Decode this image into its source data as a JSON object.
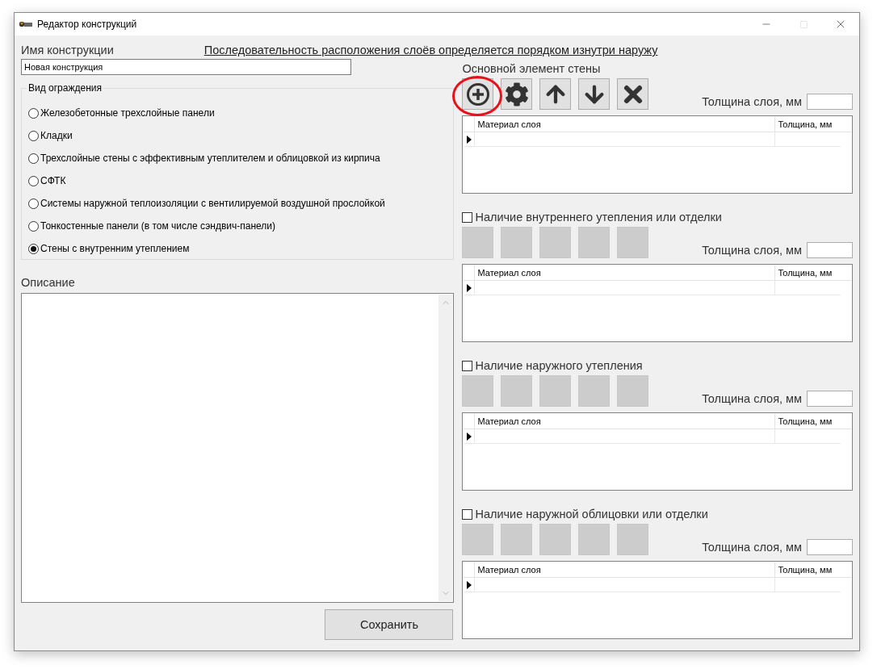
{
  "window": {
    "title": "Редактор конструкций"
  },
  "name_field": {
    "label": "Имя конструкции",
    "value": "Новая конструкция"
  },
  "hint_link": "Последовательность расположения слоёв определяется порядком изнутри наружу",
  "enclosure_group": {
    "title": "Вид ограждения",
    "options": [
      {
        "label": "Железобетонные трехслойные панели",
        "selected": false
      },
      {
        "label": "Кладки",
        "selected": false
      },
      {
        "label": "Трехслойные стены с эффективным утеплителем и облицовкой из кирпича",
        "selected": false
      },
      {
        "label": "СФТК",
        "selected": false
      },
      {
        "label": "Системы наружной теплоизоляции с вентилируемой воздушной прослойкой",
        "selected": false
      },
      {
        "label": "Тонкостенные панели (в том числе сэндвич-панели)",
        "selected": false
      },
      {
        "label": "Стены с внутренним утеплением",
        "selected": true
      }
    ]
  },
  "description": {
    "label": "Описание"
  },
  "save_button": "Сохранить",
  "sections": [
    {
      "kind": "label",
      "title": "Основной элемент стены",
      "buttons": [
        {
          "kind": "add",
          "highlighted": true
        },
        {
          "kind": "settings",
          "highlighted": false
        },
        {
          "kind": "up",
          "highlighted": false
        },
        {
          "kind": "down",
          "highlighted": false
        },
        {
          "kind": "delete",
          "highlighted": false
        }
      ],
      "thickness_label": "Толщина слоя, мм",
      "columns": [
        "Материал слоя",
        "Толщина, мм"
      ]
    },
    {
      "kind": "checkbox",
      "checked": false,
      "title": "Наличие внутреннего утепления или отделки",
      "buttons": [
        {
          "kind": "blank",
          "highlighted": false
        },
        {
          "kind": "blank",
          "highlighted": false
        },
        {
          "kind": "blank",
          "highlighted": false
        },
        {
          "kind": "blank",
          "highlighted": false
        },
        {
          "kind": "blank",
          "highlighted": false
        }
      ],
      "thickness_label": "Толщина слоя, мм",
      "columns": [
        "Материал слоя",
        "Толщина, мм"
      ]
    },
    {
      "kind": "checkbox",
      "checked": false,
      "title": "Наличие наружного утепления",
      "buttons": [
        {
          "kind": "blank",
          "highlighted": false
        },
        {
          "kind": "blank",
          "highlighted": false
        },
        {
          "kind": "blank",
          "highlighted": false
        },
        {
          "kind": "blank",
          "highlighted": false
        },
        {
          "kind": "blank",
          "highlighted": false
        }
      ],
      "thickness_label": "Толщина слоя, мм",
      "columns": [
        "Материал слоя",
        "Толщина, мм"
      ]
    },
    {
      "kind": "checkbox",
      "checked": false,
      "title": "Наличие наружной облицовки или отделки",
      "buttons": [
        {
          "kind": "blank",
          "highlighted": false
        },
        {
          "kind": "blank",
          "highlighted": false
        },
        {
          "kind": "blank",
          "highlighted": false
        },
        {
          "kind": "blank",
          "highlighted": false
        },
        {
          "kind": "blank",
          "highlighted": false
        }
      ],
      "thickness_label": "Толщина слоя, мм",
      "columns": [
        "Материал слоя",
        "Толщина, мм"
      ]
    }
  ]
}
